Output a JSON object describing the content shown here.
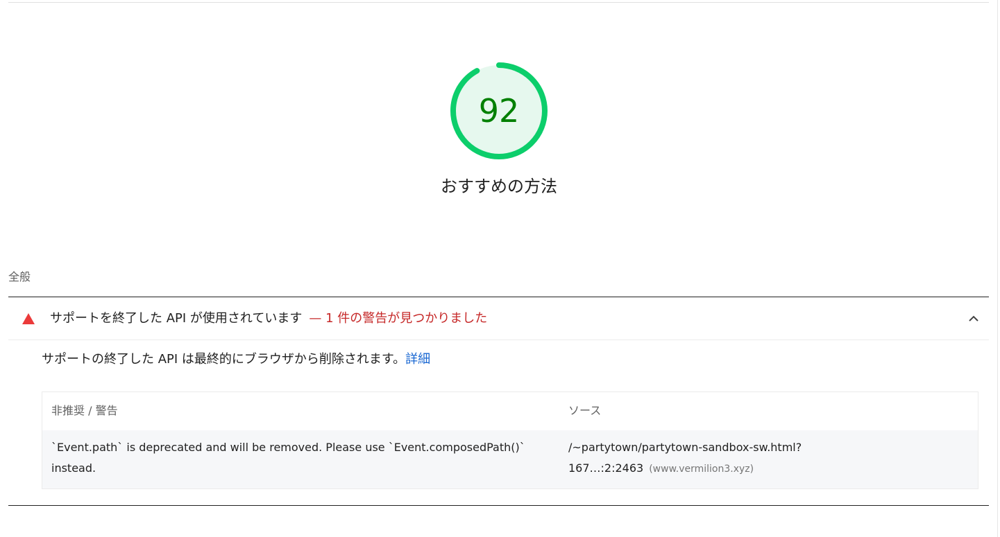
{
  "score": {
    "value": 92,
    "percent": 92,
    "color": "#0cce6b",
    "track_color": "#e6f8ee",
    "text_color": "#008000"
  },
  "category": {
    "title": "おすすめの方法"
  },
  "group": {
    "title": "全般"
  },
  "audit": {
    "title": "サポートを終了した API が使用されています",
    "warning": "— 1 件の警告が見つかりました",
    "description": "サポートの終了した API は最終的にブラウザから削除されます。",
    "learn_more": "詳細",
    "icon": "warning-triangle-icon",
    "icon_color": "#eb3a3a",
    "expanded": true
  },
  "table": {
    "headers": [
      "非推奨 / 警告",
      "ソース"
    ],
    "rows": [
      {
        "message": "`Event.path` is deprecated and will be removed. Please use `Event.composedPath()` instead.",
        "source_url": "/~partytown/partytown-sandbox-sw.html?",
        "source_loc": "167…:2:2463",
        "source_origin": "(www.vermilion3.xyz)"
      }
    ]
  }
}
